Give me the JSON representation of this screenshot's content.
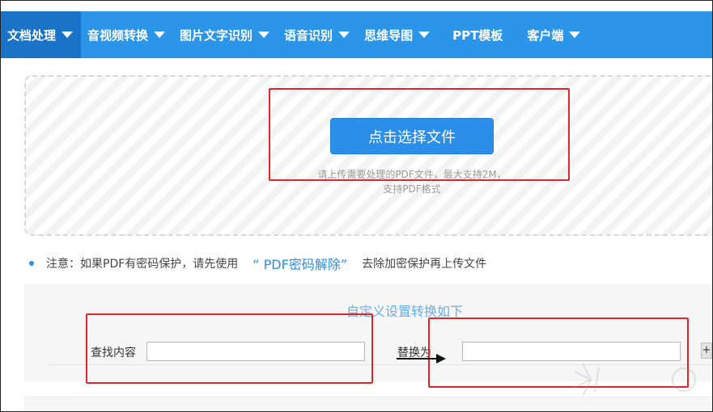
{
  "nav": {
    "items": [
      {
        "label": "文档处理",
        "has_dropdown": true,
        "active": true
      },
      {
        "label": "音视频转换",
        "has_dropdown": true,
        "active": false
      },
      {
        "label": "图片文字识别",
        "has_dropdown": true,
        "active": false
      },
      {
        "label": "语音识别",
        "has_dropdown": true,
        "active": false
      },
      {
        "label": "思维导图",
        "has_dropdown": true,
        "active": false
      },
      {
        "label": "PPT模板",
        "has_dropdown": false,
        "active": false
      },
      {
        "label": "客户端",
        "has_dropdown": true,
        "active": false
      }
    ]
  },
  "upload": {
    "button_label": "点击选择文件",
    "hint_line1": "请上传需要处理的PDF文件，最大支持2M，",
    "hint_line2": "支持PDF格式"
  },
  "notice": {
    "prefix": "注意：如果PDF有密码保护，请先使用",
    "link": "“ PDF密码解除”",
    "suffix": "去除加密保护再上传文件"
  },
  "settings": {
    "title": "自定义设置转换如下",
    "find_label": "查找内容",
    "find_value": "",
    "replace_label": "替换为",
    "replace_value": "",
    "add_label": "+"
  },
  "colors": {
    "nav_bg": "#2b95e9",
    "nav_active": "#1a72c9",
    "accent": "#2b8ee8",
    "annotation_red": "#e0262b"
  }
}
